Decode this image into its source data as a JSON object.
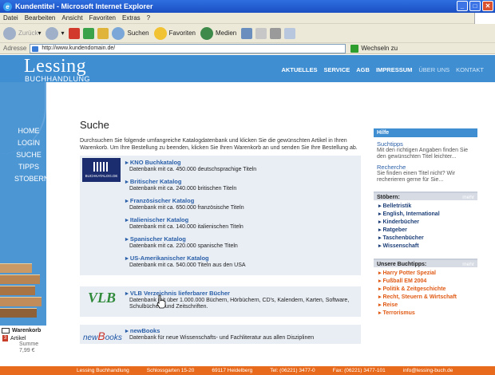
{
  "window": {
    "title": "Kundentitel - Microsoft Internet Explorer"
  },
  "menu": [
    "Datei",
    "Bearbeiten",
    "Ansicht",
    "Favoriten",
    "Extras",
    "?"
  ],
  "toolbar": {
    "back": "Zurück",
    "search": "Suchen",
    "favorites": "Favoriten",
    "media": "Medien"
  },
  "address": {
    "label": "Adresse",
    "url": "http://www.kundendomain.de/",
    "go": "Wechseln zu"
  },
  "site": {
    "logo": "Lessing",
    "logo_sub": "BUCHHANDLUNG",
    "topnav": [
      "AKTUELLES",
      "SERVICE",
      "AGB",
      "IMPRESSUM",
      "ÜBER UNS",
      "KONTAKT"
    ],
    "leftnav": [
      "HOME",
      "LOGIN",
      "SUCHE",
      "TIPPS",
      "STOBERN"
    ]
  },
  "cart": {
    "title": "Warenkorb",
    "count": "3",
    "items_label": "Artikel",
    "sum_label": "Summe",
    "sum": "7,99 €"
  },
  "main": {
    "title": "Suche",
    "intro": "Durchsuchen Sie folgende umfangreiche Katalogdatenbank und klicken Sie die gewünschten Artikel in Ihren Warenkorb. Um Ihre Bestellung zu beenden, klicken Sie Ihren Warenkorb an und senden Sie Ihre Bestellung ab.",
    "logo_buchkatalog": "BUCHKATALOG.DE",
    "catalogs": [
      {
        "name": "KNO Buchkatalog",
        "desc": "Datenbank mit ca. 450.000 deutschsprachige Titeln"
      },
      {
        "name": "Britischer Katalog",
        "desc": "Datenbank mit ca. 240.000 britischen Titeln"
      },
      {
        "name": "Französischer Katalog",
        "desc": "Datenbank mit ca. 650.000 französische Titeln"
      },
      {
        "name": "Italienischer Katalog",
        "desc": "Datenbank mit ca. 140.000 italienischen Titeln"
      },
      {
        "name": "Spanischer Katalog",
        "desc": "Datenbank mit ca. 220.000 spanische Titeln"
      },
      {
        "name": "US-Amerikanischer Katalog",
        "desc": "Datenbank mit ca. 540.000 Titeln aus den USA"
      }
    ],
    "vlb": {
      "logo": "VLB",
      "name": "VLB Verzeichnis lieferbarer Bücher",
      "desc": "Datenbank mit über 1.000.000 Büchern, Hörbüchern, CD's, Kalendern, Karten, Software, Schulbüchern und Zeitschriften."
    },
    "newbooks": {
      "logo_pre": "new",
      "logo_b": "B",
      "logo_post": "ooks",
      "name": "newBooks",
      "desc": "Datenbank für neue Wissenschafts- und Fachliteratur aus allen Disziplinen"
    }
  },
  "sidebar": {
    "hilfe": "Hilfe",
    "tips": [
      {
        "title": "Suchtipps",
        "desc": "Mit den richtigen Angaben finden Sie den gewünschten Titel leichter..."
      },
      {
        "title": "Recherche",
        "desc": "Sie finden einen Titel nicht? Wir recherieren gerne für Sie..."
      }
    ],
    "stoebern": {
      "title": "Stöbern:",
      "more": "mehr",
      "items": [
        "Belletristik",
        "English, International",
        "Kinderbücher",
        "Ratgeber",
        "Taschenbücher",
        "Wissenschaft"
      ]
    },
    "buchtipps": {
      "title": "Unsere Buchtipps:",
      "more": "mehr",
      "items": [
        "Harry Potter Spezial",
        "Fußball EM 2004",
        "Politik & Zeitgeschichte",
        "Recht, Steuern & Wirtschaft",
        "Reise",
        "Terrorismus"
      ]
    }
  },
  "footer": [
    "Lessing Buchhandlung",
    "Schlossgarten 15-20",
    "69117 Heidelberg",
    "Tel: (06221) 3477-0",
    "Fax: (06221) 3477-101",
    "info@lessing-buch.de"
  ],
  "colors": {
    "brand_blue": "#3f8ed2",
    "accent_orange": "#e86a1c",
    "link_blue": "#2a5fa8"
  }
}
